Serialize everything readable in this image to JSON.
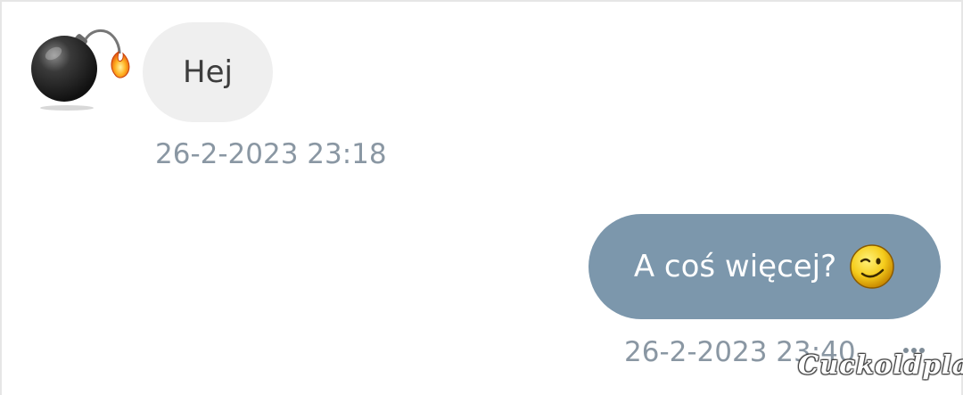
{
  "conversation": {
    "messages": [
      {
        "direction": "incoming",
        "text": "Hej",
        "timestamp": "26-2-2023 23:18",
        "avatar_icon": "bomb-icon"
      },
      {
        "direction": "outgoing",
        "text": "A coś więcej?",
        "emoji_icon": "wink-emoji-icon",
        "timestamp": "26-2-2023 23:40"
      }
    ],
    "more_icon": "more-options-icon"
  },
  "watermark": {
    "text": "Cuckoldplace"
  },
  "colors": {
    "incoming_bubble": "#efefef",
    "outgoing_bubble": "#7c97ac",
    "timestamp": "#8a97a3",
    "incoming_text": "#3d3d3d",
    "outgoing_text": "#ffffff"
  }
}
